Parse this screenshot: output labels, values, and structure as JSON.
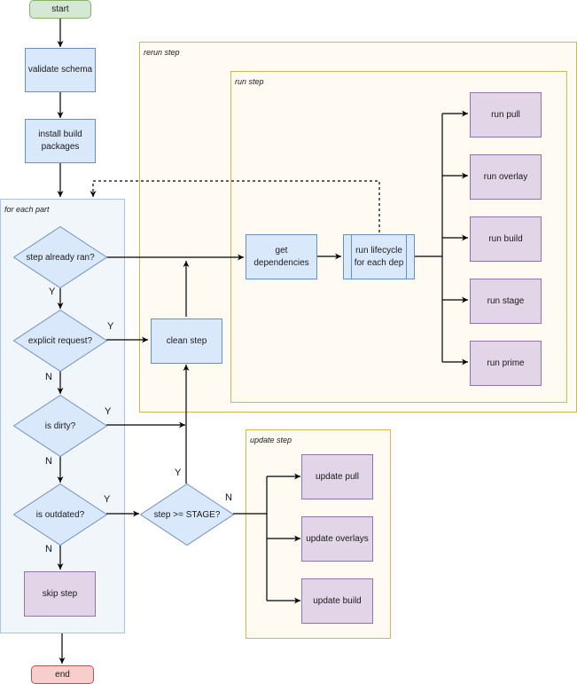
{
  "containers": {
    "for_each_part": "for each part",
    "rerun_step": "rerun step",
    "run_step": "run step",
    "update_step": "update step"
  },
  "nodes": {
    "start": "start",
    "validate_schema": "validate schema",
    "install_build_packages": "install build packages",
    "step_already_ran": "step already ran?",
    "explicit_request": "explicit request?",
    "is_dirty": "is dirty?",
    "is_outdated": "is outdated?",
    "skip_step": "skip step",
    "end": "end",
    "clean_step": "clean step",
    "step_ge_stage": "step >= STAGE?",
    "get_dependencies": "get dependencies",
    "run_lifecycle": "run lifecycle for each dep",
    "run_pull": "run pull",
    "run_overlay": "run overlay",
    "run_build": "run build",
    "run_stage": "run stage",
    "run_prime": "run prime",
    "update_pull": "update pull",
    "update_overlays": "update overlays",
    "update_build": "update build"
  },
  "edge_labels": {
    "already_ran_yes": "Y",
    "explicit_yes": "Y",
    "explicit_no": "N",
    "dirty_yes": "Y",
    "dirty_no": "N",
    "outdated_yes": "Y",
    "outdated_no": "N",
    "stage_yes": "Y",
    "stage_no": "N"
  },
  "colors": {
    "process_fill": "#dae8fc",
    "process_stroke": "#6c8ebf",
    "step_fill": "#e1d5e7",
    "step_stroke": "#9673a6",
    "start_fill": "#d5e8d4",
    "end_fill": "#f8cecc",
    "group_stroke": "#d6b656"
  }
}
